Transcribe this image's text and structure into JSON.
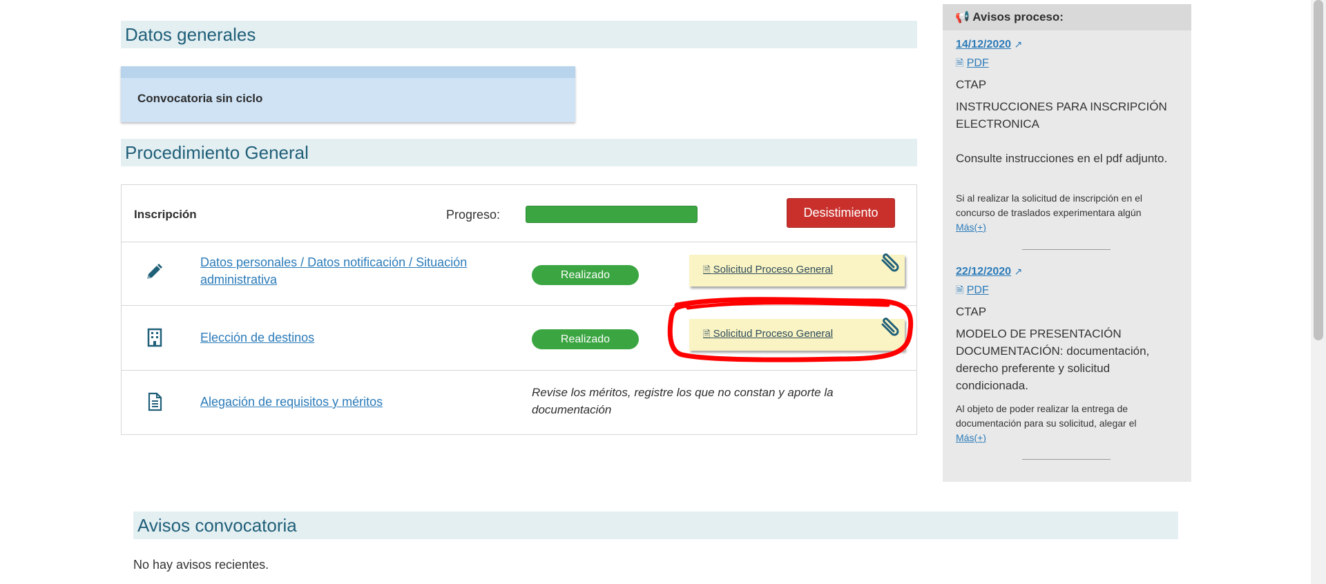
{
  "datos_generales": {
    "title": "Datos generales",
    "convocatoria": "Convocatoria sin ciclo"
  },
  "procedimiento": {
    "title": "Procedimiento General",
    "inscripcion_label": "Inscripción",
    "progreso_label": "Progreso:",
    "progress_fraction": 1.0,
    "desistimiento_label": "Desistimiento",
    "rows": [
      {
        "icon": "pencil-icon",
        "label": "Datos personales / Datos notificación / Situación administrativa",
        "status": "Realizado",
        "attachment": "Solicitud Proceso General"
      },
      {
        "icon": "building-icon",
        "label": "Elección de destinos",
        "status": "Realizado",
        "attachment": "Solicitud Proceso General"
      },
      {
        "icon": "document-icon",
        "label": "Alegación de requisitos y méritos",
        "note": "Revise los méritos, registre los que no constan y aporte la documentación"
      }
    ]
  },
  "avisos_proceso": {
    "title": "Avisos proceso:",
    "items": [
      {
        "date": "14/12/2020",
        "pdf": "PDF",
        "org": "CTAP",
        "heading": "INSTRUCCIONES PARA INSCRIPCIÓN ELECTRONICA",
        "summary": "Consulte instrucciones en el pdf adjunto.",
        "excerpt": "Si al realizar la solicitud de inscripción en el concurso de traslados experimentara algún",
        "more": "Más(+)"
      },
      {
        "date": "22/12/2020",
        "pdf": "PDF",
        "org": "CTAP",
        "heading": "MODELO DE PRESENTACIÓN DOCUMENTACIÓN: documentación, derecho preferente y solicitud condicionada.",
        "excerpt": "Al objeto de poder realizar la entrega de documentación para su solicitud, alegar el",
        "more": "Más(+)"
      }
    ]
  },
  "avisos_convocatoria": {
    "title": "Avisos convocatoria",
    "empty": "No hay avisos recientes."
  },
  "colors": {
    "accent": "#1f5f78",
    "link": "#2b7bb9",
    "success": "#3aa541",
    "danger": "#c9302c",
    "annotation": "#ff0000"
  }
}
